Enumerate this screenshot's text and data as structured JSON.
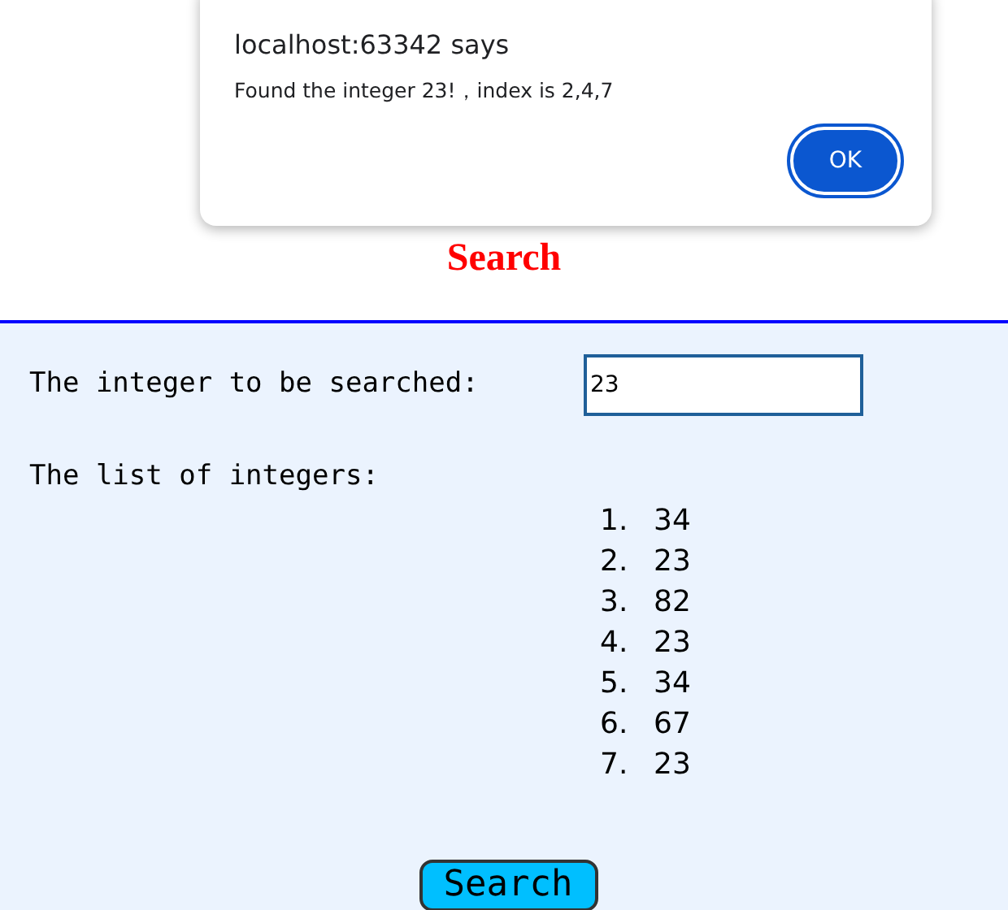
{
  "dialog": {
    "title": "localhost:63342 says",
    "message": "Found the integer 23!，index is 2,4,7",
    "button": "OK"
  },
  "heading": "Search",
  "search_field": {
    "label": "The integer to be searched:",
    "value": "23"
  },
  "list": {
    "label": "The list of integers:",
    "items": [
      {
        "number": "1.",
        "value": "34"
      },
      {
        "number": "2.",
        "value": "23"
      },
      {
        "number": "3.",
        "value": "82"
      },
      {
        "number": "4.",
        "value": "23"
      },
      {
        "number": "5.",
        "value": "34"
      },
      {
        "number": "6.",
        "value": "67"
      },
      {
        "number": "7.",
        "value": "23"
      }
    ]
  },
  "search_button": "Search"
}
